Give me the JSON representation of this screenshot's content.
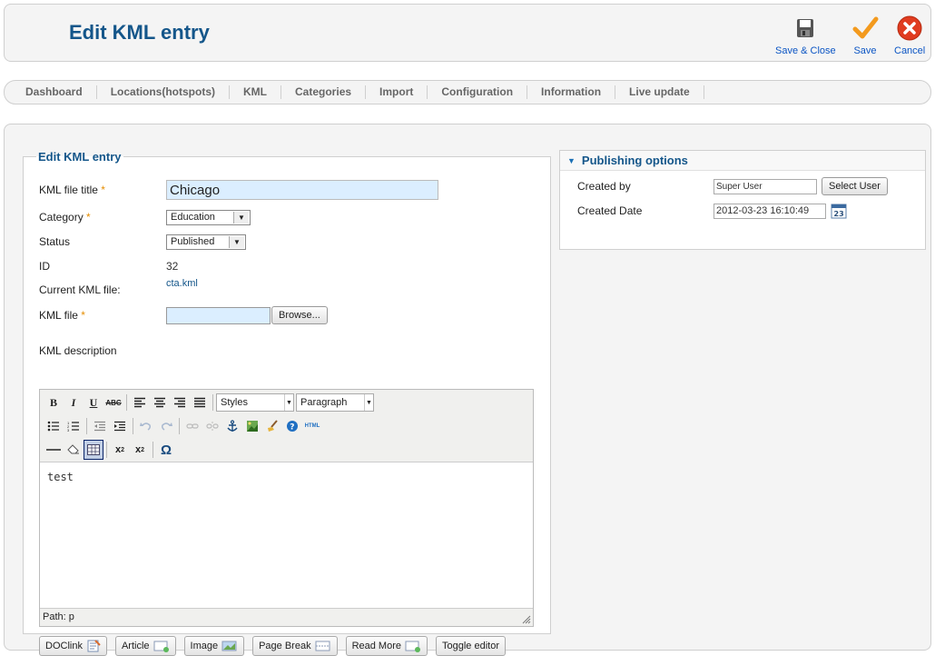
{
  "header": {
    "title": "Edit KML entry",
    "buttons": [
      {
        "label": "Save & Close",
        "icon": "save-close-icon"
      },
      {
        "label": "Save",
        "icon": "checkmark-icon"
      },
      {
        "label": "Cancel",
        "icon": "cancel-icon"
      }
    ]
  },
  "submenu": [
    "Dashboard",
    "Locations(hotspots)",
    "KML",
    "Categories",
    "Import",
    "Configuration",
    "Information",
    "Live update"
  ],
  "form": {
    "legend": "Edit KML entry",
    "title_label": "KML file title",
    "title_value": "Chicago",
    "category_label": "Category",
    "category_value": "Education",
    "status_label": "Status",
    "status_value": "Published",
    "id_label": "ID",
    "id_value": "32",
    "current_file_label": "Current KML file:",
    "current_file_value": "cta.kml",
    "file_label": "KML file",
    "browse_label": "Browse...",
    "required_mark": "*",
    "description_label": "KML description"
  },
  "editor": {
    "styles_select": "Styles",
    "format_select": "Paragraph",
    "content": "test",
    "path": "Path: p",
    "extra_buttons": [
      "DOClink",
      "Article",
      "Image",
      "Page Break",
      "Read More",
      "Toggle editor"
    ]
  },
  "publishing": {
    "title": "Publishing options",
    "created_by_label": "Created by",
    "created_by_value": "Super User",
    "select_user_label": "Select User",
    "created_date_label": "Created Date",
    "created_date_value": "2012-03-23 16:10:49"
  },
  "colors": {
    "title_blue": "#14568a",
    "link_blue": "#0b55c4",
    "required_orange": "#e58d00",
    "input_highlight": "#dbeeff"
  }
}
